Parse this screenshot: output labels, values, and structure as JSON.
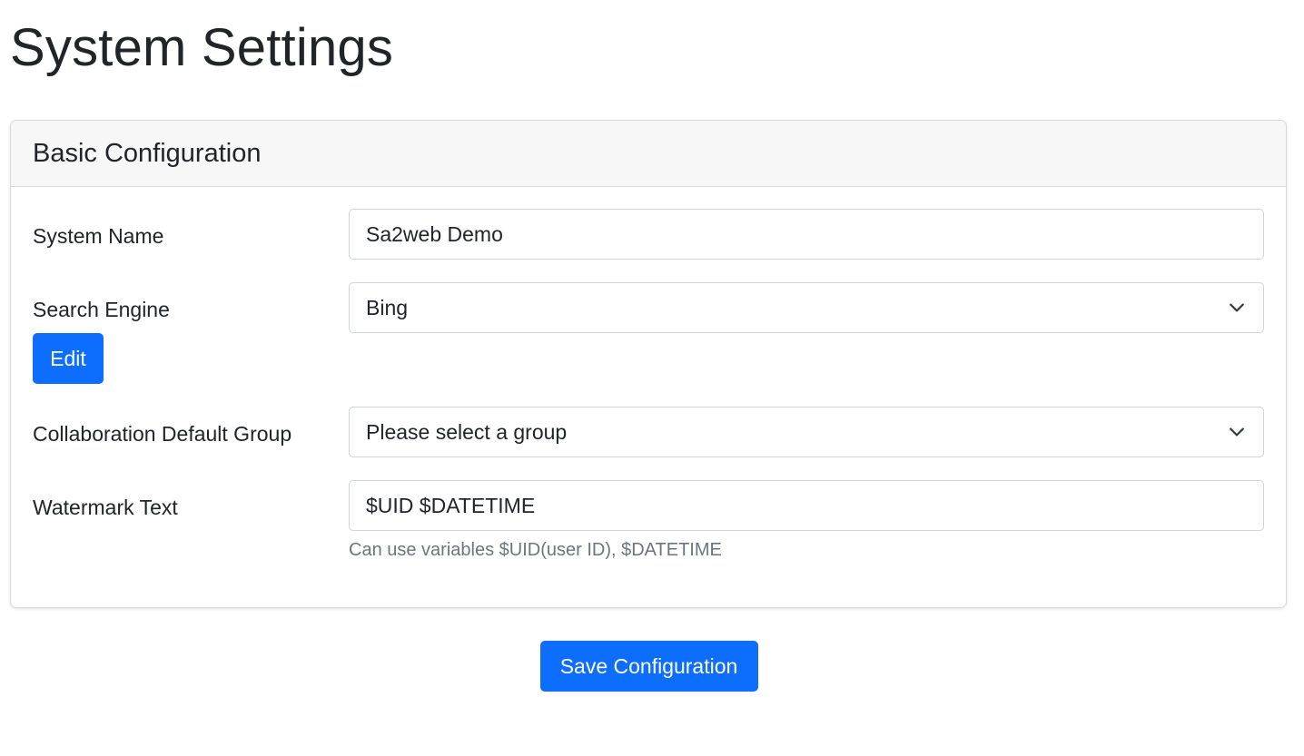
{
  "page": {
    "title": "System Settings"
  },
  "card": {
    "title": "Basic Configuration"
  },
  "fields": {
    "system_name": {
      "label": "System Name",
      "value": "Sa2web Demo"
    },
    "search_engine": {
      "label": "Search Engine",
      "selected": "Bing",
      "edit_label": "Edit"
    },
    "collab_group": {
      "label": "Collaboration Default Group",
      "selected": "Please select a group"
    },
    "watermark": {
      "label": "Watermark Text",
      "value": "$UID $DATETIME",
      "help": "Can use variables $UID(user ID), $DATETIME"
    }
  },
  "footer": {
    "save_label": "Save Configuration"
  },
  "colors": {
    "primary": "#0d6efd",
    "text": "#212529",
    "muted": "#6c757d",
    "border": "#ced4da",
    "card_header_bg": "#f7f7f7"
  },
  "icons": {
    "select_arrow": "chevron-down-icon"
  }
}
